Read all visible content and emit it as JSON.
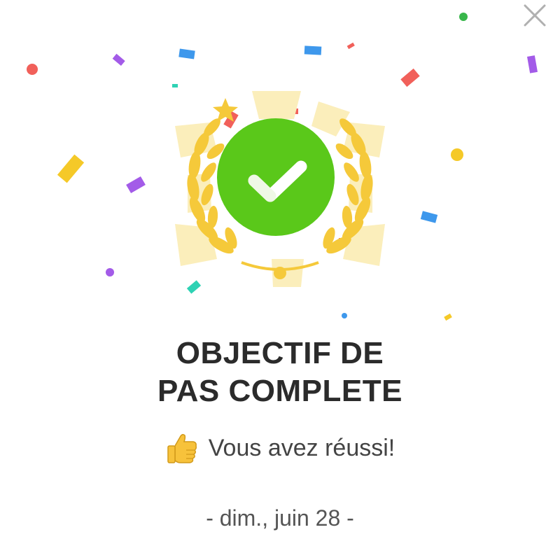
{
  "dialog": {
    "title_line1": "OBJECTIF DE",
    "title_line2": "PAS COMPLETE",
    "subtitle": "Vous avez réussi!",
    "date": "- dim., juin 28 -"
  },
  "icons": {
    "close": "close-icon",
    "thumbs": "thumbs-up-icon",
    "badge": "checkmark-icon",
    "laurel": "laurel-wreath-icon"
  },
  "colors": {
    "badge_green": "#5ac81a",
    "gold": "#f5c93a",
    "ray": "#fbeebb",
    "title": "#2b2b2b",
    "text": "#444444",
    "close": "#b0b0b0"
  }
}
